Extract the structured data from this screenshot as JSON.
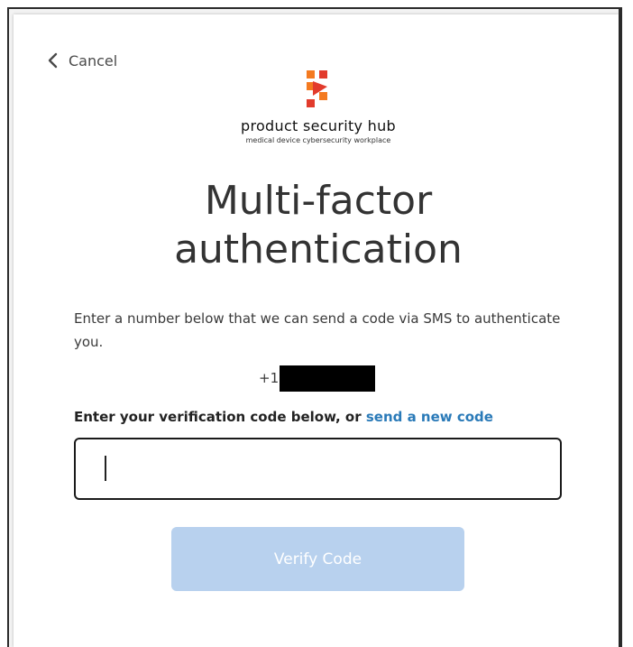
{
  "nav": {
    "cancel_label": "Cancel"
  },
  "brand": {
    "name": "product security hub",
    "tagline": "medical device cybersecurity workplace",
    "logo_colors": {
      "orange": "#f47a20",
      "red": "#e23b2c"
    }
  },
  "page": {
    "title_line1": "Multi-factor",
    "title_line2": "authentication",
    "description": "Enter a number below that we can send a code via SMS to authenticate you."
  },
  "phone": {
    "prefix": "+1"
  },
  "code": {
    "label_text": "Enter your verification code below, or ",
    "resend_link": "send a new code",
    "input_value": "",
    "input_placeholder": ""
  },
  "actions": {
    "verify_label": "Verify Code",
    "verify_color": "#b8d1ee"
  },
  "colors": {
    "link": "#2a7ab8",
    "title": "#333333"
  }
}
